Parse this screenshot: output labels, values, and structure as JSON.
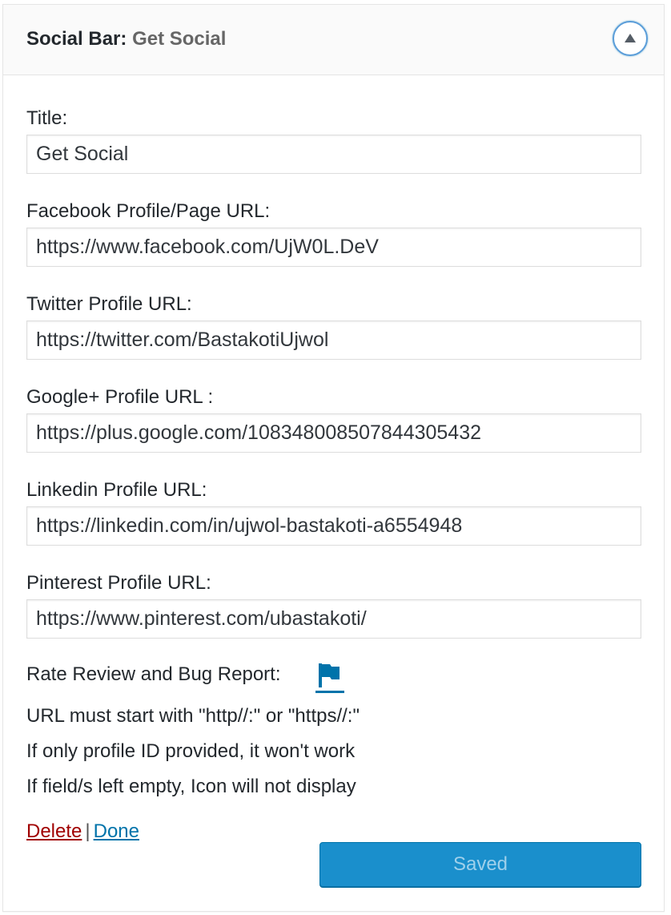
{
  "widget": {
    "title_prefix": "Social Bar",
    "title_separator": ":",
    "title_suffix": "Get Social",
    "toggle_icon": "arrow-up-icon"
  },
  "fields": {
    "title": {
      "label": "Title:",
      "value": "Get Social"
    },
    "facebook": {
      "label": "Facebook Profile/Page URL:",
      "value": "https://www.facebook.com/UjW0L.DeV"
    },
    "twitter": {
      "label": "Twitter Profile URL:",
      "value": "https://twitter.com/BastakotiUjwol"
    },
    "googleplus": {
      "label": "Google+ Profile URL :",
      "value": "https://plus.google.com/108348008507844305432"
    },
    "linkedin": {
      "label": "Linkedin Profile URL:",
      "value": "https://linkedin.com/in/ujwol-bastakoti-a6554948"
    },
    "pinterest": {
      "label": "Pinterest Profile URL:",
      "value": "https://www.pinterest.com/ubastakoti/"
    }
  },
  "notes": {
    "rate_review_label": "Rate Review and Bug Report:",
    "rate_review_icon": "flag-icon",
    "url_rule": "URL must start with \"http//:\" or \"https//:\"",
    "id_rule": "If only profile ID provided, it won't work",
    "empty_rule": "If field/s left empty, Icon will not display"
  },
  "actions": {
    "delete_label": "Delete",
    "separator": "|",
    "done_label": "Done",
    "save_label": "Saved"
  },
  "colors": {
    "accent": "#0073aa",
    "delete": "#a00000",
    "save_bg": "#1a8fcc",
    "save_text_disabled": "#9fd0eb"
  }
}
